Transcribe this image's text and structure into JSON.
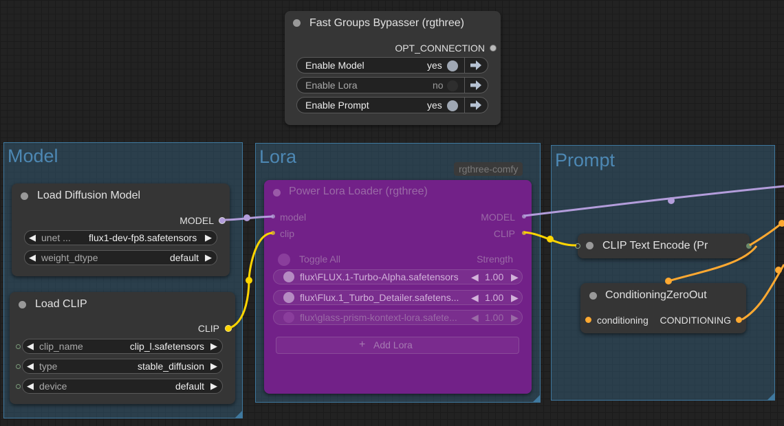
{
  "colors": {
    "model_link": "#b39ddb",
    "clip_link": "#ffd500",
    "conditioning_link": "#ffa931",
    "group_title": "#4d88b4",
    "lora_node_bg": "#76208a"
  },
  "bypasser": {
    "title": "Fast Groups Bypasser (rgthree)",
    "output": "OPT_CONNECTION",
    "toggles": [
      {
        "label": "Enable Model",
        "value": "yes",
        "enabled": true
      },
      {
        "label": "Enable Lora",
        "value": "no",
        "enabled": false
      },
      {
        "label": "Enable Prompt",
        "value": "yes",
        "enabled": true
      }
    ],
    "nav_icon": "arrow-right-icon"
  },
  "groups": {
    "model": {
      "title": "Model"
    },
    "lora": {
      "title": "Lora",
      "badge": "rgthree-comfy"
    },
    "prompt": {
      "title": "Prompt"
    }
  },
  "load_diffusion": {
    "title": "Load Diffusion Model",
    "output": "MODEL",
    "widgets": [
      {
        "name": "unet ...",
        "value": "flux1-dev-fp8.safetensors"
      },
      {
        "name": "weight_dtype",
        "value": "default"
      }
    ]
  },
  "load_clip": {
    "title": "Load CLIP",
    "output": "CLIP",
    "widgets": [
      {
        "name": "clip_name",
        "value": "clip_l.safetensors"
      },
      {
        "name": "type",
        "value": "stable_diffusion"
      },
      {
        "name": "device",
        "value": "default"
      }
    ]
  },
  "lora_loader": {
    "title": "Power Lora Loader (rgthree)",
    "inputs": [
      "model",
      "clip"
    ],
    "outputs": [
      "MODEL",
      "CLIP"
    ],
    "toggle_all": "Toggle All",
    "strength_header": "Strength",
    "loras": [
      {
        "name": "flux\\FLUX.1-Turbo-Alpha.safetensors",
        "strength": "1.00",
        "enabled": true
      },
      {
        "name": "flux\\Flux.1_Turbo_Detailer.safetens...",
        "strength": "1.00",
        "enabled": true
      },
      {
        "name": "flux\\glass-prism-kontext-lora.safete...",
        "strength": "1.00",
        "enabled": false
      }
    ],
    "add_label": "Add Lora"
  },
  "clip_encode": {
    "title": "CLIP Text Encode (Pr"
  },
  "cond_zero": {
    "title": "ConditioningZeroOut",
    "input": "conditioning",
    "output": "CONDITIONING"
  }
}
